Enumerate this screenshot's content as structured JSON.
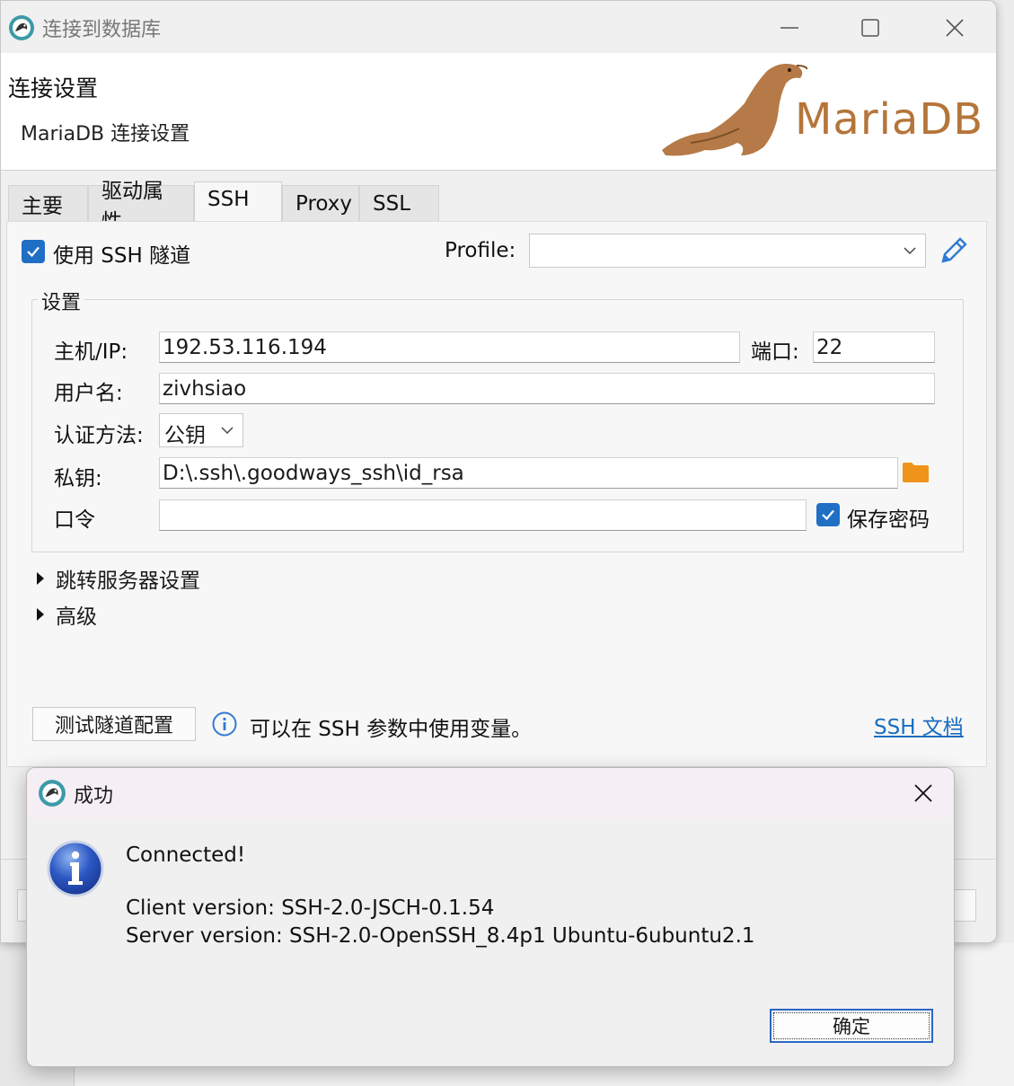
{
  "window": {
    "title": "连接到数据库"
  },
  "header": {
    "title": "连接设置",
    "subtitle": "MariaDB 连接设置",
    "logo_text": "MariaDB"
  },
  "tabs": [
    {
      "label": "主要"
    },
    {
      "label": "驱动属性"
    },
    {
      "label": "SSH",
      "active": true
    },
    {
      "label": "Proxy"
    },
    {
      "label": "SSL"
    }
  ],
  "ssh": {
    "use_tunnel_label": "使用 SSH 隧道",
    "use_tunnel_checked": true,
    "profile_label": "Profile:",
    "profile_value": "",
    "settings_title": "设置",
    "host_label": "主机/IP:",
    "host_value": "192.53.116.194",
    "port_label": "端口:",
    "port_value": "22",
    "user_label": "用户名:",
    "user_value": "zivhsiao",
    "auth_label": "认证方法:",
    "auth_value": "公钥",
    "key_label": "私钥:",
    "key_value": "D:\\.ssh\\.goodways_ssh\\id_rsa",
    "pass_label": "口令",
    "pass_value": "",
    "save_pass_label": "保存密码",
    "save_pass_checked": true,
    "jump_server_label": "跳转服务器设置",
    "advanced_label": "高级",
    "test_button": "测试隧道配置",
    "info_text": "可以在 SSH 参数中使用变量。",
    "doc_link": "SSH 文档"
  },
  "dialog": {
    "title": "成功",
    "line1": "Connected!",
    "line2": "Client version: SSH-2.0-JSCH-0.1.54",
    "line3": "Server version: SSH-2.0-OpenSSH_8.4p1 Ubuntu-6ubuntu2.1",
    "ok_label": "确定"
  },
  "colors": {
    "accent": "#1f6fc5",
    "link": "#1a6ec0",
    "logo": "#b57539",
    "folder": "#f0931a"
  }
}
